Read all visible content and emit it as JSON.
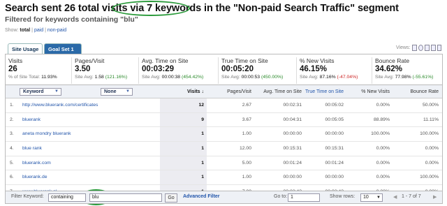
{
  "header": {
    "title": "Search sent 26 total visits via 7 keywords in the \"Non-paid Search Traffic\" segment",
    "subtitle": "Filtered for keywords containing \"blu\"",
    "show_label": "Show:",
    "show_total": "total",
    "show_sep1": "|",
    "show_paid": "paid",
    "show_sep2": "|",
    "show_nonpaid": "non-paid"
  },
  "tabs": [
    {
      "label": "Site Usage",
      "active": true
    },
    {
      "label": "Goal Set 1",
      "active": false
    }
  ],
  "views_label": "Views:",
  "metrics": [
    {
      "label": "Visits",
      "value": "26",
      "sub_prefix": "% of Site Total: ",
      "sub_value": "11.93%",
      "sub_change": ""
    },
    {
      "label": "Pages/Visit",
      "value": "3.50",
      "sub_prefix": "Site Avg: ",
      "sub_value": "1.58",
      "sub_change": "(121.16%)"
    },
    {
      "label": "Avg. Time on Site",
      "value": "00:03:29",
      "sub_prefix": "Site Avg: ",
      "sub_value": "00:00:38",
      "sub_change": "(454.42%)"
    },
    {
      "label": "True Time on Site",
      "value": "00:05:20",
      "sub_prefix": "Site Avg: ",
      "sub_value": "00:00:53",
      "sub_change": "(450.00%)"
    },
    {
      "label": "% New Visits",
      "value": "46.15%",
      "sub_prefix": "Site Avg: ",
      "sub_value": "87.16%",
      "sub_change": "(-47.04%)"
    },
    {
      "label": "Bounce Rate",
      "value": "34.62%",
      "sub_prefix": "Site Avg: ",
      "sub_value": "77.98%",
      "sub_change": "(-55.61%)"
    }
  ],
  "table": {
    "dim1": "Keyword",
    "dim2": "None",
    "columns": [
      "Visits ↓",
      "Pages/Visit",
      "Avg. Time on Site",
      "True Time on Site",
      "% New Visits",
      "Bounce Rate"
    ],
    "rows": [
      {
        "n": "1.",
        "kw": "http://www.bluerank.com/certificates",
        "visits": "12",
        "ppv": "2.67",
        "avg": "00:02:31",
        "true": "00:05:02",
        "new": "0.00%",
        "bounce": "50.00%"
      },
      {
        "n": "2.",
        "kw": "bluerank",
        "visits": "9",
        "ppv": "3.67",
        "avg": "00:04:31",
        "true": "00:05:05",
        "new": "88.89%",
        "bounce": "11.11%"
      },
      {
        "n": "3.",
        "kw": "aneta mondry bluerank",
        "visits": "1",
        "ppv": "1.00",
        "avg": "00:00:00",
        "true": "00:00:00",
        "new": "100.00%",
        "bounce": "100.00%"
      },
      {
        "n": "4.",
        "kw": "blue rank",
        "visits": "1",
        "ppv": "12.00",
        "avg": "00:15:31",
        "true": "00:15:31",
        "new": "0.00%",
        "bounce": "0.00%"
      },
      {
        "n": "5.",
        "kw": "bluerank.com",
        "visits": "1",
        "ppv": "5.00",
        "avg": "00:01:24",
        "true": "00:01:24",
        "new": "0.00%",
        "bounce": "0.00%"
      },
      {
        "n": "6.",
        "kw": "bluerank.de",
        "visits": "1",
        "ppv": "1.00",
        "avg": "00:00:00",
        "true": "00:00:00",
        "new": "0.00%",
        "bounce": "100.00%"
      },
      {
        "n": "7.",
        "kw": "www.bluerank.pl",
        "visits": "1",
        "ppv": "7.00",
        "avg": "00:02:43",
        "true": "00:02:43",
        "new": "0.00%",
        "bounce": "0.00%"
      }
    ]
  },
  "footer": {
    "filter_label": "Filter Keyword:",
    "filter_mode": "containing",
    "filter_value": "blu",
    "go1": "Go",
    "advanced": "Advanced Filter",
    "goto_label": "Go to:",
    "goto_value": "1",
    "show_rows_label": "Show rows:",
    "show_rows_value": "10",
    "paging": "1 - 7 of 7"
  },
  "colors": {
    "accent": "#2b6aa8",
    "oval": "#2a9a3a",
    "positive": "#2a8a2a",
    "negative": "#cc2222"
  }
}
